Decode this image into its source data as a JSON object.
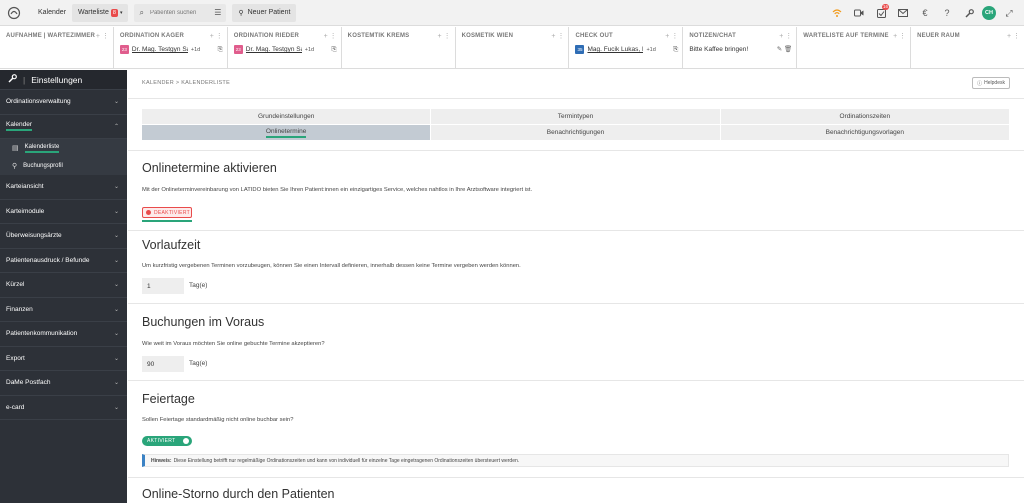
{
  "topbar": {
    "calendar": "Kalender",
    "waitlist": "Warteliste",
    "waitlist_badge": "8",
    "search_placeholder": "Patienten suchen",
    "new_patient": "Neuer Patient",
    "notif_badge": "16",
    "avatar": "CH"
  },
  "rooms": [
    {
      "title": "AUFNAHME | WARTEZIMMER",
      "entries": []
    },
    {
      "title": "ORDINATION KAGER",
      "entries": [
        {
          "badge": "23",
          "color": "#e05d8d",
          "name": "Dr. Mag. Testgyn Sabi...",
          "extra": "+1d"
        }
      ]
    },
    {
      "title": "ORDINATION RIEDER",
      "entries": [
        {
          "badge": "23",
          "color": "#e05d8d",
          "name": "Dr. Mag. Testgyn Sabi...",
          "extra": "+1d"
        }
      ]
    },
    {
      "title": "KOSTEMTIK KREMS",
      "entries": []
    },
    {
      "title": "KOSMETIK WIEN",
      "entries": []
    },
    {
      "title": "CHECK OUT",
      "entries": [
        {
          "badge": "35",
          "color": "#2f6db5",
          "name": "Mag. Fucik Lukas, Ms...",
          "extra": "+1d"
        }
      ]
    },
    {
      "title": "NOTIZEN/CHAT",
      "entries": [
        {
          "note": "Bitte Kaffee bringen!"
        }
      ]
    },
    {
      "title": "WARTELISTE AUF TERMINE",
      "entries": []
    },
    {
      "title": "NEUER RAUM",
      "entries": []
    }
  ],
  "sidebar": {
    "header": "Einstellungen",
    "items": [
      {
        "label": "Ordinationsverwaltung"
      },
      {
        "label": "Kalender",
        "open": true,
        "subs": [
          {
            "label": "Kalenderliste",
            "active": true
          },
          {
            "label": "Buchungsprofil"
          }
        ]
      },
      {
        "label": "Karteiansicht"
      },
      {
        "label": "Karteimodule"
      },
      {
        "label": "Überweisungsärzte"
      },
      {
        "label": "Patientenausdruck / Befunde"
      },
      {
        "label": "Kürzel"
      },
      {
        "label": "Finanzen"
      },
      {
        "label": "Patientenkommunikation"
      },
      {
        "label": "Export"
      },
      {
        "label": "DaMe Postfach"
      },
      {
        "label": "e-card"
      }
    ]
  },
  "main": {
    "breadcrumb": "KALENDER > KALENDERLISTE",
    "helpdesk": "Helpdesk",
    "tabs": [
      "Grundeinstellungen",
      "Termintypen",
      "Ordinationszeiten",
      "Onlinetermine",
      "Benachrichtigungen",
      "Benachrichtigungsvorlagen"
    ],
    "active_tab": "Onlinetermine",
    "sections": {
      "online": {
        "title": "Onlinetermine aktivieren",
        "text": "Mit der Onlineterminvereinbarung von LATIDO bieten Sie Ihren Patient:innen ein einzigartiges Service, welches nahtlos in Ihre Arztsoftware integriert ist.",
        "status": "DEAKTIVIERT"
      },
      "lead": {
        "title": "Vorlaufzeit",
        "text": "Um kurzfristig vergebenen Terminen vorzubeugen, können Sie einen Intervall definieren, innerhalb dessen keine Termine vergeben werden können.",
        "value": "1",
        "unit": "Tag(e)"
      },
      "ahead": {
        "title": "Buchungen im Voraus",
        "text": "Wie weit im Voraus möchten Sie online gebuchte Termine akzeptieren?",
        "value": "90",
        "unit": "Tag(e)"
      },
      "holidays": {
        "title": "Feiertage",
        "text": "Sollen Feiertage standardmäßig nicht online buchbar sein?",
        "status": "AKTIVIERT",
        "hint_label": "Hinweis:",
        "hint": "Diese Einstellung betrifft nur regelmäßige Ordinationszeiten und kann von individuell für einzelne Tage eingetragenen Ordinationszeiten übersteuert werden."
      },
      "storno": {
        "title": "Online-Storno durch den Patienten"
      }
    }
  },
  "colors": {
    "accent": "#2aa57a",
    "danger": "#e94b4b",
    "sidebar": "#2d3138",
    "info": "#3b82c4"
  }
}
